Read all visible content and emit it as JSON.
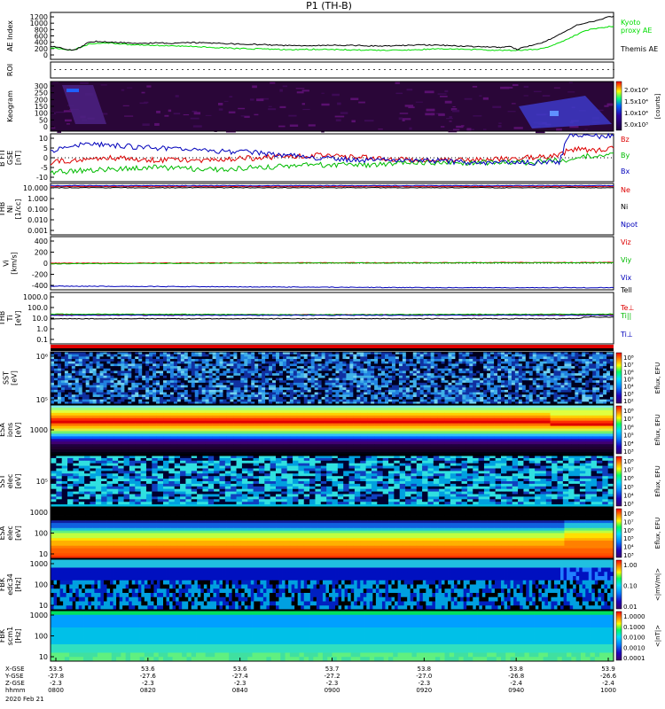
{
  "chart_data": {
    "type": "line",
    "title": "P1 (TH-B)",
    "date_label": "2020 Feb 21",
    "time_axis": {
      "row_labels": [
        "X-GSE",
        "Y-GSE",
        "Z-GSE",
        "hhmm"
      ],
      "ticks": [
        {
          "x": "53.5",
          "y": "-27.8",
          "z": "-2.3",
          "t": "0800"
        },
        {
          "x": "53.6",
          "y": "-27.6",
          "z": "-2.3",
          "t": "0820"
        },
        {
          "x": "53.6",
          "y": "-27.4",
          "z": "-2.3",
          "t": "0840"
        },
        {
          "x": "53.7",
          "y": "-27.2",
          "z": "-2.3",
          "t": "0900"
        },
        {
          "x": "53.8",
          "y": "-27.0",
          "z": "-2.3",
          "t": "0920"
        },
        {
          "x": "53.8",
          "y": "-26.8",
          "z": "-2.4",
          "t": "0940"
        },
        {
          "x": "53.9",
          "y": "-26.6",
          "z": "-2.4",
          "t": "1000"
        }
      ]
    },
    "panels": [
      {
        "id": "ae",
        "ylabel": "AE Index",
        "yticks": [
          "1200",
          "1000",
          "800",
          "600",
          "400",
          "200",
          "0"
        ],
        "ylim": [
          0,
          1200
        ],
        "series": [
          {
            "name": "Kyoto\nproxy AE",
            "color": "#00dd00",
            "values": [
              [
                0,
                300
              ],
              [
                8,
                280
              ],
              [
                20,
                240
              ],
              [
                28,
                260
              ],
              [
                36,
                320
              ],
              [
                45,
                400
              ],
              [
                55,
                420
              ],
              [
                70,
                410
              ],
              [
                90,
                380
              ],
              [
                110,
                360
              ],
              [
                130,
                355
              ],
              [
                150,
                340
              ],
              [
                170,
                320
              ],
              [
                190,
                300
              ],
              [
                210,
                280
              ],
              [
                230,
                270
              ],
              [
                250,
                260
              ],
              [
                270,
                250
              ],
              [
                290,
                255
              ],
              [
                310,
                260
              ],
              [
                330,
                250
              ],
              [
                350,
                240
              ],
              [
                370,
                235
              ],
              [
                390,
                230
              ],
              [
                410,
                240
              ],
              [
                430,
                260
              ],
              [
                450,
                270
              ],
              [
                470,
                260
              ],
              [
                490,
                245
              ],
              [
                510,
                235
              ],
              [
                525,
                230
              ],
              [
                540,
                240
              ],
              [
                555,
                260
              ],
              [
                565,
                300
              ],
              [
                575,
                380
              ],
              [
                585,
                480
              ],
              [
                595,
                580
              ],
              [
                605,
                680
              ],
              [
                615,
                760
              ],
              [
                620,
                780
              ],
              [
                627,
                810
              ],
              [
                635,
                830
              ],
              [
                642,
                850
              ]
            ]
          },
          {
            "name": "Themis AE",
            "color": "#000000",
            "values": [
              [
                0,
                330
              ],
              [
                8,
                320
              ],
              [
                18,
                250
              ],
              [
                26,
                240
              ],
              [
                34,
                300
              ],
              [
                42,
                430
              ],
              [
                52,
                460
              ],
              [
                62,
                450
              ],
              [
                80,
                430
              ],
              [
                100,
                410
              ],
              [
                120,
                420
              ],
              [
                140,
                410
              ],
              [
                160,
                430
              ],
              [
                180,
                420
              ],
              [
                200,
                400
              ],
              [
                220,
                390
              ],
              [
                240,
                380
              ],
              [
                260,
                360
              ],
              [
                280,
                350
              ],
              [
                300,
                355
              ],
              [
                320,
                365
              ],
              [
                340,
                360
              ],
              [
                360,
                350
              ],
              [
                380,
                340
              ],
              [
                400,
                355
              ],
              [
                420,
                370
              ],
              [
                440,
                365
              ],
              [
                460,
                345
              ],
              [
                480,
                330
              ],
              [
                500,
                320
              ],
              [
                515,
                310
              ],
              [
                525,
                330
              ],
              [
                532,
                240
              ],
              [
                540,
                320
              ],
              [
                550,
                360
              ],
              [
                560,
                420
              ],
              [
                570,
                520
              ],
              [
                580,
                640
              ],
              [
                590,
                760
              ],
              [
                600,
                870
              ],
              [
                610,
                940
              ],
              [
                620,
                980
              ],
              [
                628,
                1020
              ],
              [
                636,
                1080
              ],
              [
                642,
                1100
              ]
            ]
          }
        ]
      },
      {
        "id": "roi",
        "ylabel": "ROI"
      },
      {
        "id": "keogram",
        "ylabel": "Keogram",
        "yticks": [
          "300",
          "250",
          "200",
          "150",
          "100",
          "50",
          "0"
        ],
        "colorbar": {
          "label": "[counts]",
          "ticks": [
            "2.0x10⁴",
            "1.5x10⁴",
            "1.0x10⁴",
            "5.0x10³"
          ]
        }
      },
      {
        "id": "bfield",
        "ylabel": "B FIT\nGSE\n[nT]",
        "yticks": [
          "10",
          "5",
          "0",
          "-5",
          "-10"
        ],
        "ylim": [
          -10,
          10
        ],
        "series": [
          {
            "name": "Bz",
            "color": "#dd0000",
            "values": [
              [
                0,
                -2
              ],
              [
                60,
                0
              ],
              [
                120,
                -1
              ],
              [
                180,
                -1
              ],
              [
                240,
                0
              ],
              [
                300,
                1
              ],
              [
                360,
                0
              ],
              [
                420,
                -1
              ],
              [
                480,
                -1
              ],
              [
                540,
                0
              ],
              [
                580,
                1
              ],
              [
                590,
                3
              ],
              [
                600,
                3.5
              ],
              [
                620,
                3
              ],
              [
                642,
                4
              ]
            ]
          },
          {
            "name": "By",
            "color": "#00bb00",
            "values": [
              [
                0,
                -6
              ],
              [
                60,
                -5
              ],
              [
                120,
                -4
              ],
              [
                180,
                -5
              ],
              [
                240,
                -4
              ],
              [
                300,
                -3
              ],
              [
                360,
                -3
              ],
              [
                420,
                -2
              ],
              [
                480,
                -2
              ],
              [
                540,
                -2
              ],
              [
                590,
                -1
              ],
              [
                600,
                0
              ],
              [
                620,
                1
              ],
              [
                642,
                2
              ]
            ]
          },
          {
            "name": "Bx",
            "color": "#0000bb",
            "values": [
              [
                0,
                3
              ],
              [
                40,
                6
              ],
              [
                80,
                5
              ],
              [
                120,
                4
              ],
              [
                180,
                3
              ],
              [
                240,
                2
              ],
              [
                300,
                0
              ],
              [
                360,
                -1
              ],
              [
                420,
                -1
              ],
              [
                480,
                -2
              ],
              [
                540,
                -2
              ],
              [
                580,
                -2
              ],
              [
                590,
                9
              ],
              [
                642,
                9
              ]
            ]
          }
        ]
      },
      {
        "id": "density",
        "ylabel": "THB\nNi\n[1/cc]",
        "yticks": [
          "10.000",
          "1.000",
          "0.100",
          "0.010",
          "0.001"
        ],
        "ylim": [
          -3,
          1
        ],
        "log": true,
        "series": [
          {
            "name": "Ne",
            "color": "#dd0000",
            "values": [
              [
                0,
                0.95
              ],
              [
                642,
                0.95
              ]
            ]
          },
          {
            "name": "Ni",
            "color": "#000000",
            "values": [
              [
                0,
                0.85
              ],
              [
                642,
                0.85
              ]
            ]
          },
          {
            "name": "Npot",
            "color": "#0000bb",
            "values": [
              [
                0,
                1.02
              ],
              [
                642,
                1.02
              ]
            ]
          }
        ]
      },
      {
        "id": "velocity",
        "ylabel": "Vi\n[km/s]",
        "yticks": [
          "400",
          "200",
          "0",
          "-200",
          "-400"
        ],
        "ylim": [
          -500,
          500
        ],
        "series": [
          {
            "name": "Viz",
            "color": "#dd0000",
            "values": [
              [
                0,
                0
              ],
              [
                200,
                5
              ],
              [
                400,
                10
              ],
              [
                642,
                15
              ]
            ]
          },
          {
            "name": "Viy",
            "color": "#00bb00",
            "values": [
              [
                0,
                -10
              ],
              [
                200,
                0
              ],
              [
                400,
                5
              ],
              [
                642,
                10
              ]
            ]
          },
          {
            "name": "Vix",
            "color": "#0000bb",
            "values": [
              [
                0,
                -430
              ],
              [
                150,
                -440
              ],
              [
                300,
                -450
              ],
              [
                450,
                -460
              ],
              [
                642,
                -460
              ]
            ]
          }
        ]
      },
      {
        "id": "temperature",
        "ylabel": "THB\nTi\n[eV]",
        "yticks": [
          "1000.0",
          "100.0",
          "10.0",
          "1.0",
          "0.1"
        ],
        "ylim": [
          -1,
          3
        ],
        "log": true,
        "series": [
          {
            "name": "Tell",
            "color": "#000000",
            "values": [
              [
                0,
                0.95
              ],
              [
                600,
                0.95
              ],
              [
                610,
                1.1
              ],
              [
                642,
                1.1
              ]
            ]
          },
          {
            "name": "Te⊥",
            "color": "#dd0000",
            "values": [
              [
                0,
                1.3
              ],
              [
                642,
                1.3
              ]
            ]
          },
          {
            "name": "Ti||",
            "color": "#00bb00",
            "values": [
              [
                0,
                1.35
              ],
              [
                300,
                1.3
              ],
              [
                642,
                1.35
              ]
            ]
          },
          {
            "name": "Ti⊥",
            "color": "#0000bb",
            "values": [
              [
                0,
                1.25
              ],
              [
                642,
                1.25
              ]
            ]
          }
        ]
      },
      {
        "id": "sst_ion",
        "ylabel": "SST\n[eV]",
        "yticks": [
          "10⁶",
          "10⁵"
        ],
        "colorbar": {
          "label": "Eflux, EFU",
          "ticks": [
            "10⁸",
            "10⁷",
            "10⁶",
            "10⁵",
            "10⁴",
            "10³",
            "10²"
          ]
        }
      },
      {
        "id": "esa_ion",
        "ylabel": "ESA\nions\n[eV]",
        "yticks": [
          "1000"
        ],
        "colorbar": {
          "label": "Eflux, EFU",
          "ticks": [
            "10⁸",
            "10⁷",
            "10⁶",
            "10⁵",
            "10⁴",
            "10³"
          ]
        }
      },
      {
        "id": "sst_elec",
        "ylabel": "SST\nelec\n[eV]",
        "yticks": [
          "10⁵"
        ],
        "colorbar": {
          "label": "Eflux, EFU",
          "ticks": [
            "10⁸",
            "10⁷",
            "10⁶",
            "10⁵",
            "10⁴",
            "10³"
          ]
        }
      },
      {
        "id": "esa_elec",
        "ylabel": "ESA\nelec\n[eV]",
        "yticks": [
          "1000",
          "100",
          "10"
        ],
        "colorbar": {
          "label": "Eflux, EFU",
          "ticks": [
            "10⁸",
            "10⁷",
            "10⁶",
            "10⁵",
            "10⁴",
            "10³"
          ]
        }
      },
      {
        "id": "fbk_e",
        "ylabel": "FBK\nedc34\n[Hz]",
        "yticks": [
          "1000",
          "100",
          "10"
        ],
        "colorbar": {
          "label": "<|mV/m|>",
          "ticks": [
            "1.00",
            "0.10",
            "0.01"
          ]
        }
      },
      {
        "id": "fbk_b",
        "ylabel": "FBK\nscm1\n[Hz]",
        "yticks": [
          "1000",
          "100",
          "10"
        ],
        "colorbar": {
          "label": "<|nT|>",
          "ticks": [
            "1.0000",
            "0.1000",
            "0.0100",
            "0.0010",
            "0.0001"
          ]
        }
      }
    ]
  }
}
